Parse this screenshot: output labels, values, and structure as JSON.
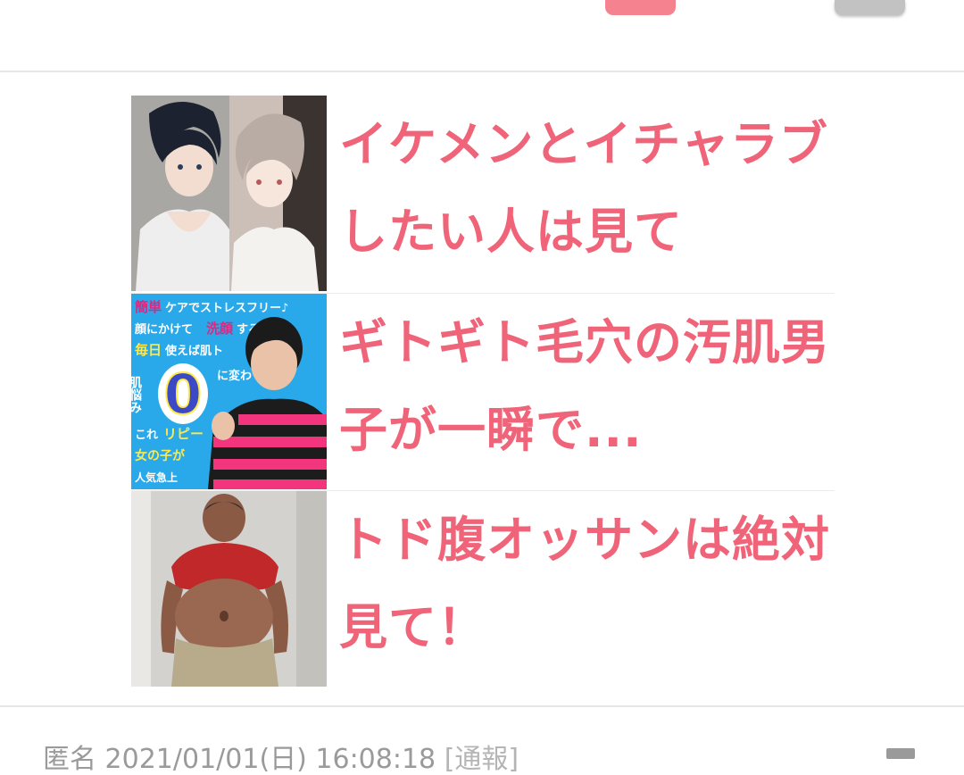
{
  "ads": [
    {
      "title_line1": "イケメンとイチャラブ",
      "title_line2": "したい人は見て"
    },
    {
      "title_line1": "ギトギト毛穴の汚肌男",
      "title_line2": "子が一瞬で...",
      "thumb_text": {
        "line1a": "簡単",
        "line1b": "ケアでストレスフリー♪",
        "line2a": "顔にかけて",
        "line2b": "洗顔",
        "line2c": "する",
        "line3a": "毎日",
        "line3b": "使えば肌ト",
        "side": "肌悩み",
        "zero": "0",
        "mid": "に変わ",
        "line5a": "これ",
        "line5b": "リピー",
        "line6": "女の子が",
        "line7": "人気急上"
      }
    },
    {
      "title_line1": "トド腹オッサンは絶対",
      "title_line2": "見て！"
    }
  ],
  "meta": {
    "name": "匿名",
    "datetime": "2021/01/01(日) 16:08:18",
    "report": "[通報]"
  },
  "colors": {
    "accent": "#ef6478",
    "button_pink": "#f5838f",
    "button_gray": "#c2c2c2"
  }
}
